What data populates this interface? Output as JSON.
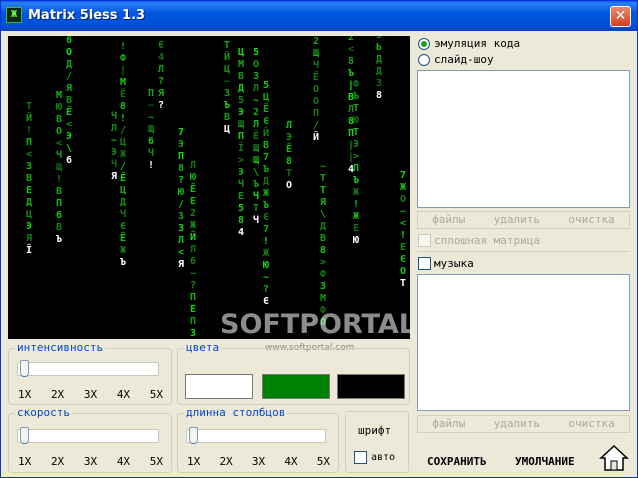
{
  "window": {
    "title": "Matrix 5less 1.3",
    "close_glyph": "✕",
    "icon_glyph": "Ж"
  },
  "preview": {
    "watermark": "SOFTPORTAL",
    "watermark_url": "www.softportal.com",
    "columns": [
      {
        "chars": "2Ж ‡",
        "color": "#13e013"
      },
      {
        "chars": "ЦЦЗL",
        "color": "#13e013"
      },
      {
        "chars": "ЪьЪ",
        "color": "#13e013"
      },
      {
        "chars": ">~ЁiЕЕ,<",
        "color": "#13e013"
      },
      {
        "chars": "ЇЬ9ВТЪ",
        "color": "#13e013"
      },
      {
        "chars": "ЕМЄОЧЛП",
        "color": "#13e013"
      }
    ],
    "accent_color": "#13e013"
  },
  "intensity": {
    "label": "интенсивность",
    "ticks": [
      "1X",
      "2X",
      "3X",
      "4X",
      "5X"
    ],
    "value_fraction": 0.0
  },
  "colors": {
    "label": "цвета",
    "swatches": [
      "#ffffff",
      "#008000",
      "#000000"
    ]
  },
  "speed": {
    "label": "скорость",
    "ticks": [
      "1X",
      "2X",
      "3X",
      "4X",
      "5X"
    ],
    "value_fraction": 0.0
  },
  "column_length": {
    "label": "длинна столбцов",
    "ticks": [
      "1X",
      "2X",
      "3X",
      "4X",
      "5X"
    ],
    "value_fraction": 0.0
  },
  "font": {
    "button_label": "шрифт",
    "auto_label": "авто",
    "auto_checked": false
  },
  "mode": {
    "options": [
      "эмуляция кода",
      "слайд-шоу"
    ],
    "selected": "эмуляция кода"
  },
  "slides": {
    "buttons": [
      "файлы",
      "удалить",
      "очистка"
    ],
    "solid_matrix_label": "сплошная матрица",
    "solid_matrix_checked": false
  },
  "music": {
    "label": "музыка",
    "checked": false,
    "buttons": [
      "файлы",
      "удалить",
      "очистка"
    ]
  },
  "footer": {
    "save": "СОХРАНИТЬ",
    "default": "УМОЛЧАНИЕ",
    "home_icon": "home-icon"
  }
}
